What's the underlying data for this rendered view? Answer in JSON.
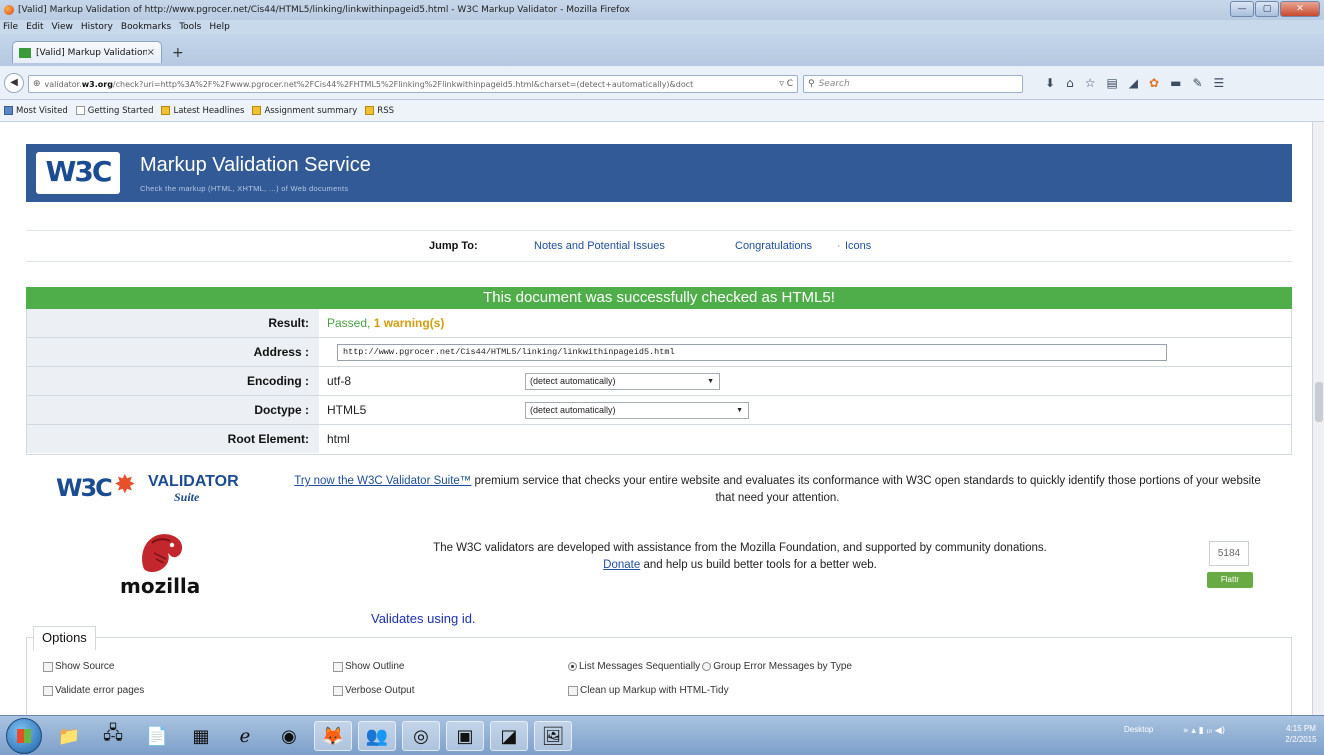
{
  "window": {
    "title": "[Valid] Markup Validation of http://www.pgrocer.net/Cis44/HTML5/linking/linkwithinpageid5.html - W3C Markup Validator - Mozilla Firefox",
    "btn_min": "—",
    "btn_max": "▢",
    "btn_close": "✕"
  },
  "menu": [
    "File",
    "Edit",
    "View",
    "History",
    "Bookmarks",
    "Tools",
    "Help"
  ],
  "tab": {
    "label": "[Valid] Markup Validation ...",
    "close": "×",
    "new": "+"
  },
  "nav": {
    "back": "◀",
    "url_prefix": "validator.",
    "url_domain": "w3.org",
    "url_rest": "/check?uri=http%3A%2F%2Fwww.pgrocer.net%2FCis44%2FHTML5%2Flinking%2Flinkwithinpageid5.html&charset=(detect+automatically)&doct",
    "reload": "▿ C",
    "search_placeholder": "Search",
    "icons": [
      "download-icon",
      "home-icon",
      "star-icon",
      "reading-list-icon",
      "send-icon",
      "addon-icon",
      "folder-icon",
      "extension-icon",
      "menu-icon"
    ]
  },
  "bookmarks": [
    "Most Visited",
    "Getting Started",
    "Latest Headlines",
    "Assignment summary",
    "RSS"
  ],
  "banner": {
    "logo": "W3C",
    "title": "Markup Validation Service",
    "subtitle": "Check the markup (HTML, XHTML, ...) of Web documents"
  },
  "jump": {
    "label": "Jump To:",
    "link1": "Notes and Potential Issues",
    "link2": "Congratulations",
    "sep": "·",
    "link3": "Icons"
  },
  "result": {
    "banner": "This document was successfully checked as HTML5!",
    "rows": {
      "result_label": "Result:",
      "result_pass": "Passed,",
      "result_warn": "1 warning(s)",
      "address_label": "Address :",
      "address_value": "http://www.pgrocer.net/Cis44/HTML5/linking/linkwithinpageid5.html",
      "encoding_label": "Encoding :",
      "encoding_value": "utf-8",
      "encoding_select": "(detect automatically)",
      "doctype_label": "Doctype :",
      "doctype_value": "HTML5",
      "doctype_select": "(detect automatically)",
      "root_label": "Root Element:",
      "root_value": "html"
    }
  },
  "suite": {
    "logo_w3c": "W3C",
    "logo_validator": "VALIDATOR",
    "logo_suite": "Suite",
    "link": "Try now the W3C Validator Suite™",
    "text": "premium service that checks your entire website and evaluates its conformance with W3C open standards to quickly identify those portions of your website that need your attention."
  },
  "mozilla": {
    "wordmark": "mozilla",
    "text1": "The W3C validators are developed with assistance from the Mozilla Foundation, and supported by community donations.",
    "donate": "Donate",
    "text2": "and help us build better tools for a better web.",
    "counter": "5184",
    "flattr": "Flattr"
  },
  "note": "Validates using id.",
  "options": {
    "title": "Options",
    "show_source": "Show Source",
    "show_outline": "Show Outline",
    "list_seq": "List Messages Sequentially",
    "group_err": "Group Error Messages by Type",
    "validate_err": "Validate error pages",
    "verbose": "Verbose Output",
    "tidy": "Clean up Markup with HTML-Tidy"
  },
  "taskbar": {
    "desktop": "Desktop",
    "tray": "» ▴ ▮ ₍ᵢₗ ◀)",
    "time": "4:15 PM",
    "date": "2/2/2015"
  }
}
